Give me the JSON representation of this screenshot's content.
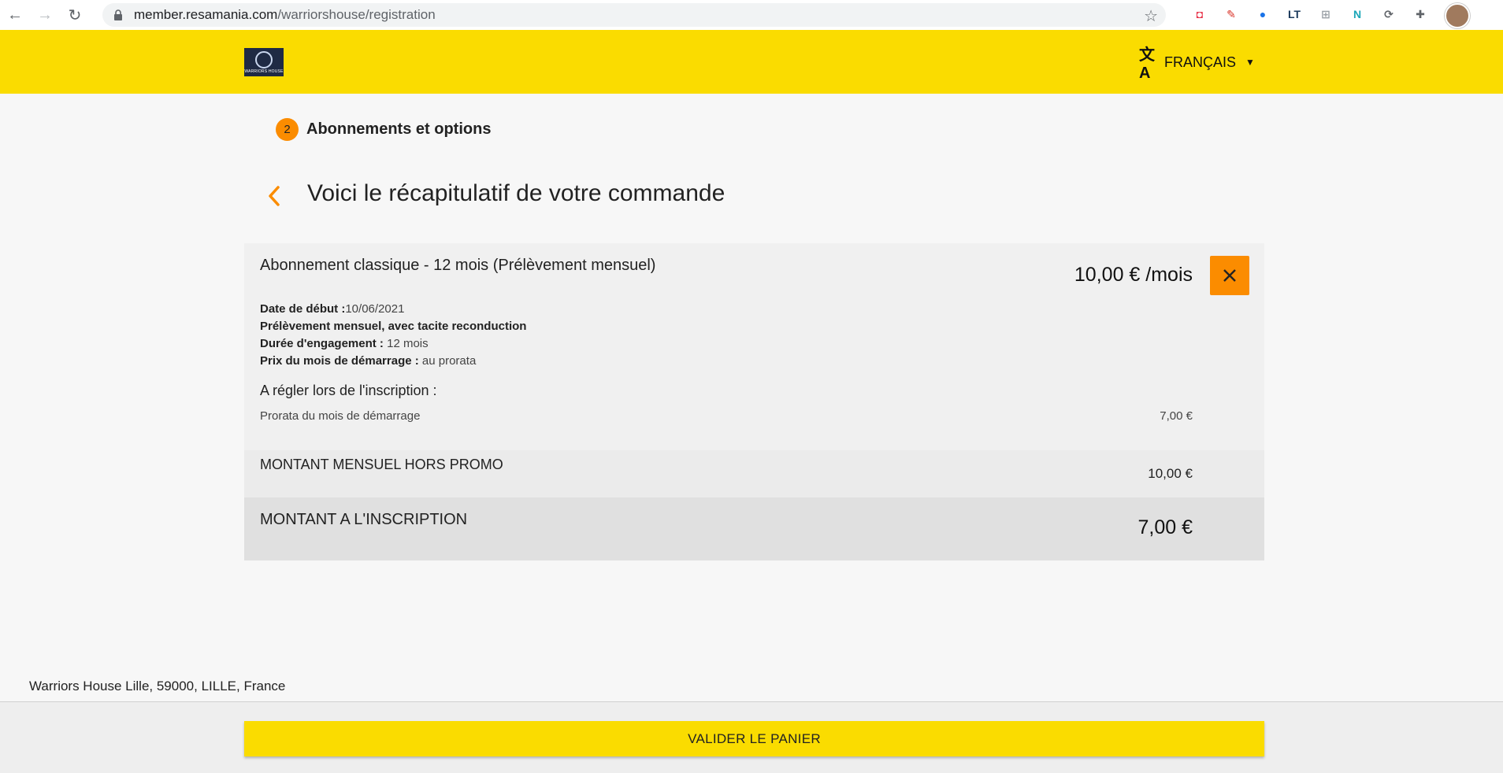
{
  "browser": {
    "url_host": "member.resamania.com",
    "url_path": "/warriorshouse/registration",
    "extensions": [
      {
        "name": "pocket-icon",
        "glyph": "◘",
        "color": "#e8334a"
      },
      {
        "name": "pen-icon",
        "glyph": "✎",
        "color": "#d93025"
      },
      {
        "name": "bird-icon",
        "glyph": "●",
        "color": "#1a73e8"
      },
      {
        "name": "languagetool-icon",
        "glyph": "LT",
        "color": "#1b3a5c"
      },
      {
        "name": "clipboard-icon",
        "glyph": "⊞",
        "color": "#9aa0a6"
      },
      {
        "name": "n-icon",
        "glyph": "N",
        "color": "#1ba6b8"
      },
      {
        "name": "sync-icon",
        "glyph": "⟳",
        "color": "#5f6368"
      },
      {
        "name": "puzzle-icon",
        "glyph": "✚",
        "color": "#5f6368"
      }
    ]
  },
  "header": {
    "logo_text": "WARRIORS HOUSE",
    "language": "FRANÇAIS"
  },
  "step": {
    "number": "2",
    "label": "Abonnements et options"
  },
  "page": {
    "title": "Voici le récapitulatif de votre commande"
  },
  "order": {
    "item_title": "Abonnement classique - 12 mois (Prélèvement mensuel)",
    "item_price": "10,00 € /mois",
    "details": {
      "start_label": "Date de début :",
      "start_value": "10/06/2021",
      "payment_line": "Prélèvement mensuel, avec tacite reconduction",
      "engagement_label": "Durée d'engagement :",
      "engagement_value": " 12 mois",
      "start_price_label": "Prix du mois de démarrage :",
      "start_price_value": " au prorata"
    },
    "due_title": "A régler lors de l'inscription :",
    "prorata_label": "Prorata du mois de démarrage",
    "prorata_value": "7,00 €",
    "monthly_label": "MONTANT MENSUEL HORS PROMO",
    "monthly_value": "10,00 €",
    "total_label": "MONTANT A L'INSCRIPTION",
    "total_value": "7,00 €"
  },
  "footer": {
    "address": "Warriors House Lille, 59000, LILLE, France",
    "validate_label": "VALIDER LE PANIER"
  },
  "colors": {
    "brand_yellow": "#fadc00",
    "accent_orange": "#fb8c00"
  }
}
